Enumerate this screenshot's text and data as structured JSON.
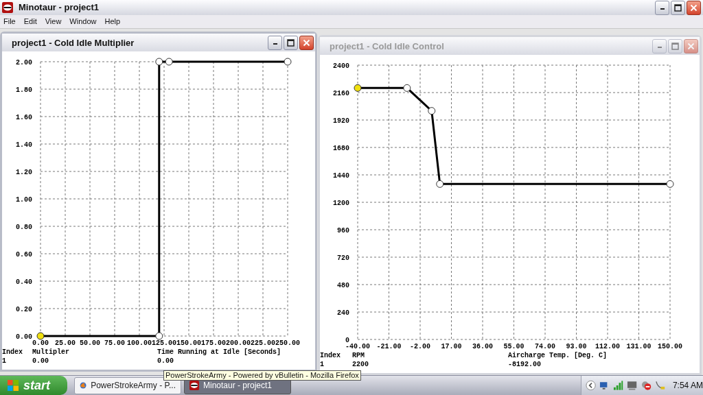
{
  "app_window": {
    "title": "Minotaur - project1"
  },
  "menu": [
    "File",
    "Edit",
    "View",
    "Window",
    "Help"
  ],
  "child_windows": [
    {
      "title": "project1 - Cold Idle Multiplier",
      "active": true,
      "points": [
        {
          "selected": true
        },
        {
          "selected": false
        },
        {
          "selected": false
        },
        {
          "selected": false
        },
        {
          "selected": false
        }
      ],
      "chart_data": {
        "type": "line",
        "grid": true,
        "x": [
          0,
          120,
          120,
          130,
          250
        ],
        "series": [
          {
            "color": "#000000",
            "marker": "circle",
            "values": [
              0,
              0,
              2,
              2,
              2
            ]
          }
        ],
        "xlim": [
          0,
          250
        ],
        "ylim": [
          0,
          2
        ],
        "xticks": [
          {
            "value": 0,
            "label": "0.00"
          },
          {
            "value": 25,
            "label": "25.00"
          },
          {
            "value": 50,
            "label": "50.00"
          },
          {
            "value": 75,
            "label": "75.00"
          },
          {
            "value": 100,
            "label": "100.00"
          },
          {
            "value": 125,
            "label": "125.00"
          },
          {
            "value": 150,
            "label": "150.00"
          },
          {
            "value": 175,
            "label": "175.00"
          },
          {
            "value": 200,
            "label": "200.00"
          },
          {
            "value": 225,
            "label": "225.00"
          },
          {
            "value": 250,
            "label": "250.00"
          }
        ],
        "yticks": [
          {
            "value": 0,
            "label": "0.00"
          },
          {
            "value": 0.2,
            "label": "0.20"
          },
          {
            "value": 0.4,
            "label": "0.40"
          },
          {
            "value": 0.6,
            "label": "0.60"
          },
          {
            "value": 0.8,
            "label": "0.80"
          },
          {
            "value": 1,
            "label": "1.00"
          },
          {
            "value": 1.2,
            "label": "1.20"
          },
          {
            "value": 1.4,
            "label": "1.40"
          },
          {
            "value": 1.6,
            "label": "1.60"
          },
          {
            "value": 1.8,
            "label": "1.80"
          },
          {
            "value": 2,
            "label": "2.00"
          }
        ]
      },
      "info": {
        "columns": [
          "Index",
          "Multipler",
          "Time Running at Idle [Seconds]"
        ],
        "values": [
          "1",
          "0.00",
          "0.00"
        ]
      }
    },
    {
      "title": "project1 - Cold Idle Control",
      "active": false,
      "points": [
        {
          "selected": true
        },
        {
          "selected": false
        },
        {
          "selected": false
        },
        {
          "selected": false
        },
        {
          "selected": false
        }
      ],
      "chart_data": {
        "type": "line",
        "grid": true,
        "x": [
          -40,
          -10,
          5,
          10,
          150
        ],
        "series": [
          {
            "color": "#000000",
            "marker": "circle",
            "values": [
              2200,
              2200,
              2000,
              1360,
              1360
            ]
          }
        ],
        "xlim": [
          -40,
          150
        ],
        "ylim": [
          0,
          2400
        ],
        "xticks": [
          {
            "value": -40,
            "label": "-40.00"
          },
          {
            "value": -21,
            "label": "-21.00"
          },
          {
            "value": -2,
            "label": "-2.00"
          },
          {
            "value": 17,
            "label": "17.00"
          },
          {
            "value": 36,
            "label": "36.00"
          },
          {
            "value": 55,
            "label": "55.00"
          },
          {
            "value": 74,
            "label": "74.00"
          },
          {
            "value": 93,
            "label": "93.00"
          },
          {
            "value": 112,
            "label": "112.00"
          },
          {
            "value": 131,
            "label": "131.00"
          },
          {
            "value": 150,
            "label": "150.00"
          }
        ],
        "yticks": [
          {
            "value": 0,
            "label": "0"
          },
          {
            "value": 240,
            "label": "240"
          },
          {
            "value": 480,
            "label": "480"
          },
          {
            "value": 720,
            "label": "720"
          },
          {
            "value": 960,
            "label": "960"
          },
          {
            "value": 1200,
            "label": "1200"
          },
          {
            "value": 1440,
            "label": "1440"
          },
          {
            "value": 1680,
            "label": "1680"
          },
          {
            "value": 1920,
            "label": "1920"
          },
          {
            "value": 2160,
            "label": "2160"
          },
          {
            "value": 2400,
            "label": "2400"
          }
        ]
      },
      "info": {
        "columns": [
          "Index",
          "RPM",
          "Aircharge Temp. [Deg. C]"
        ],
        "values": [
          "1",
          "2200",
          "-8192.00"
        ]
      }
    }
  ],
  "taskbar": {
    "start": "start",
    "tasks": [
      {
        "label": "PowerStrokeArmy - P...",
        "kind": "browser",
        "selected": false
      },
      {
        "label": "Minotaur - project1",
        "kind": "app",
        "selected": true
      }
    ],
    "clock": "7:54 AM"
  },
  "tooltip": "PowerStrokeArmy - Powered by vBulletin - Mozilla Firefox"
}
